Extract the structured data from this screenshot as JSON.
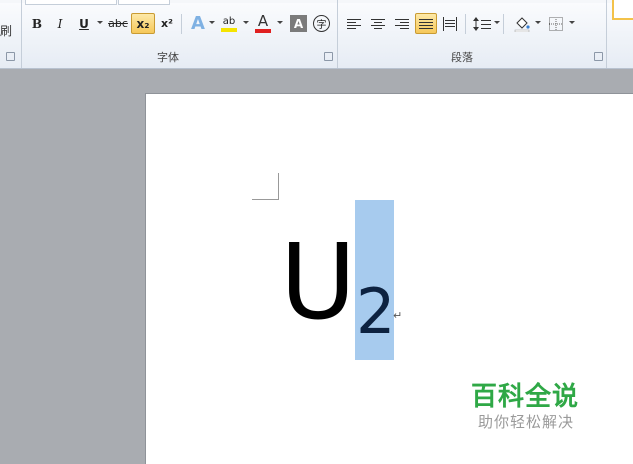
{
  "clipboard": {
    "cut_label_partial": "刷"
  },
  "font_group": {
    "label": "字体",
    "buttons": {
      "bold": "B",
      "italic": "I",
      "underline": "U",
      "strikethrough": "abc",
      "subscript": "x₂",
      "superscript": "x²",
      "text_effect": "A",
      "highlight": "ab",
      "font_color": "A",
      "char_shading": "A",
      "enclose_char": "字"
    },
    "subscript_active": true
  },
  "paragraph_group": {
    "label": "段落",
    "justify_active": true
  },
  "document": {
    "main_char": "U",
    "subscript_char": "2",
    "paragraph_mark": "↵"
  },
  "watermark": {
    "title": "百科全说",
    "subtitle": "助你轻松解决"
  },
  "colors": {
    "selection": "#a7cbee",
    "watermark_green": "#2fa846",
    "font_color_bar": "#e02020",
    "highlight_bar": "#f5e400",
    "active_button": "#f6c85a"
  }
}
